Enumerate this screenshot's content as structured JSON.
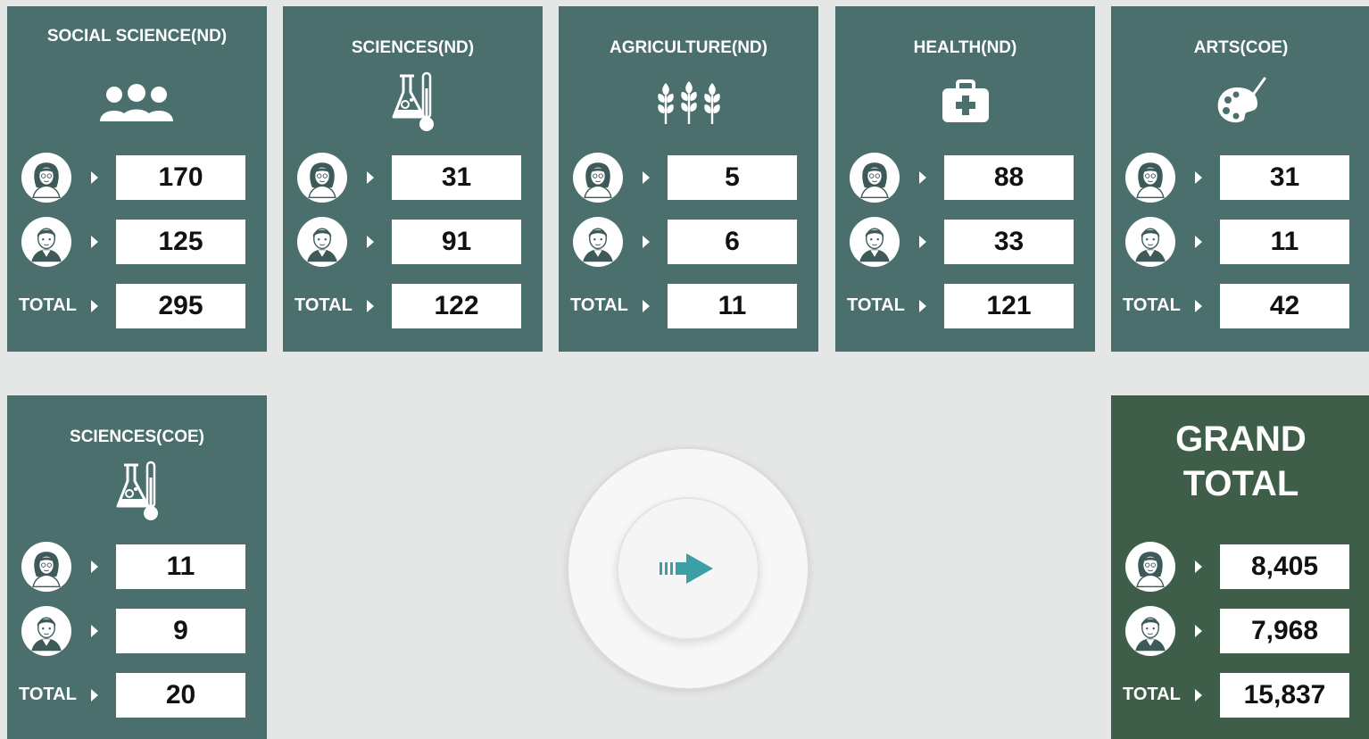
{
  "cards": [
    {
      "title": "SOCIAL SCIENCE(ND)",
      "icon": "users-group-icon",
      "female": "170",
      "male": "125",
      "total_label": "TOTAL",
      "total": "295"
    },
    {
      "title": "SCIENCES(ND)",
      "icon": "flask-thermometer-icon",
      "female": "31",
      "male": "91",
      "total_label": "TOTAL",
      "total": "122"
    },
    {
      "title": "AGRICULTURE(ND)",
      "icon": "wheat-icon",
      "female": "5",
      "male": "6",
      "total_label": "TOTAL",
      "total": "11"
    },
    {
      "title": "HEALTH(ND)",
      "icon": "medical-kit-icon",
      "female": "88",
      "male": "33",
      "total_label": "TOTAL",
      "total": "121"
    },
    {
      "title": "ARTS(COE)",
      "icon": "palette-icon",
      "female": "31",
      "male": "11",
      "total_label": "TOTAL",
      "total": "42"
    },
    {
      "title": "SCIENCES(COE)",
      "icon": "flask-thermometer-icon",
      "female": "11",
      "male": "9",
      "total_label": "TOTAL",
      "total": "20"
    }
  ],
  "grand": {
    "title_line1": "GRAND",
    "title_line2": "TOTAL",
    "female": "8,405",
    "male": "7,968",
    "total_label": "TOTAL",
    "total": "15,837"
  },
  "play_button": {
    "icon": "arrow-right-icon"
  },
  "colors": {
    "card": "#4a6f6d",
    "grand": "#3f5e4a",
    "background": "#e5e7e6",
    "accent": "#3d9fa6"
  }
}
